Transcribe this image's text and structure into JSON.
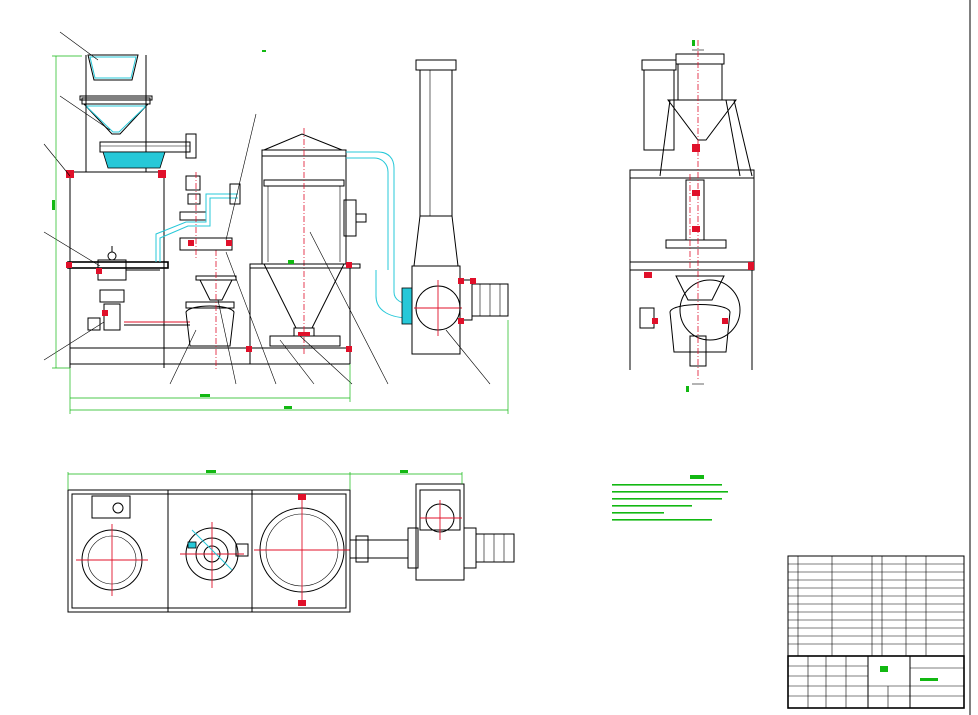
{
  "drawing": {
    "top_label": "",
    "notes_title": "",
    "notes_lines": [
      "",
      "",
      "",
      "",
      "",
      ""
    ],
    "leaders": [
      "",
      "",
      "",
      "",
      "",
      "",
      "",
      "",
      "",
      "",
      "",
      "",
      "",
      ""
    ],
    "dimensions": {
      "height": "",
      "width_total": "",
      "width_part": "",
      "plan_width_1": "",
      "plan_width_2": ""
    }
  },
  "colors": {
    "line": "#000000",
    "centerline": "#e0102a",
    "cyan_fill": "#27c8d8",
    "dimension": "#12b812",
    "background": "#ffffff"
  },
  "parts_list": {
    "rows": [
      [
        "",
        "",
        "",
        "",
        "",
        ""
      ],
      [
        "",
        "",
        "",
        "",
        "",
        ""
      ],
      [
        "",
        "",
        "",
        "",
        "",
        ""
      ],
      [
        "",
        "",
        "",
        "",
        "",
        ""
      ],
      [
        "",
        "",
        "",
        "",
        "",
        ""
      ],
      [
        "",
        "",
        "",
        "",
        "",
        ""
      ],
      [
        "",
        "",
        "",
        "",
        "",
        ""
      ],
      [
        "",
        "",
        "",
        "",
        "",
        ""
      ],
      [
        "",
        "",
        "",
        "",
        "",
        ""
      ],
      [
        "",
        "",
        "",
        "",
        "",
        ""
      ],
      [
        "",
        "",
        "",
        "",
        "",
        ""
      ],
      [
        "",
        "",
        "",
        "",
        "",
        ""
      ]
    ]
  },
  "title_block": {
    "title": "",
    "drawing_no": "",
    "scale": ""
  }
}
